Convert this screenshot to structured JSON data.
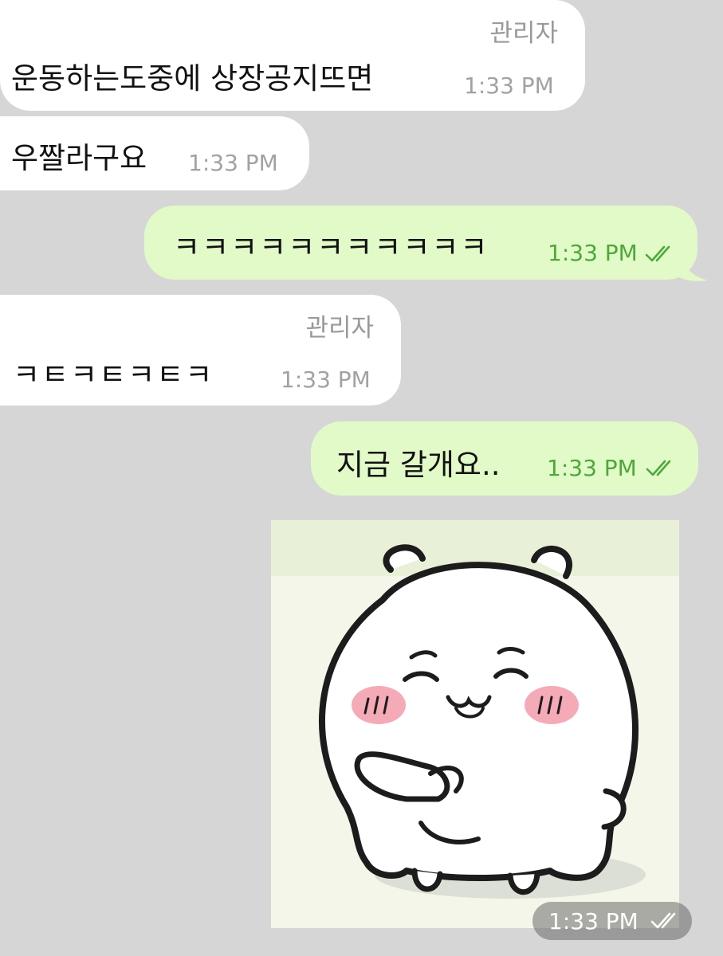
{
  "chat": {
    "messages": [
      {
        "direction": "incoming",
        "sender": "관리자",
        "text": "운동하는도중에 상장공지뜨면",
        "time": "1:33 PM"
      },
      {
        "direction": "incoming",
        "text": "우짤라구요",
        "time": "1:33 PM"
      },
      {
        "direction": "outgoing",
        "text": "ㅋㅋㅋㅋㅋㅋㅋㅋㅋㅋㅋ",
        "time": "1:33 PM",
        "status_icon": "double-check-icon"
      },
      {
        "direction": "incoming",
        "sender": "관리자",
        "text": "ㅋㅌㅋㅌㅋㅌㅋ",
        "time": "1:33 PM"
      },
      {
        "direction": "outgoing",
        "text": "지금 갈개요..",
        "time": "1:33 PM",
        "status_icon": "double-check-icon"
      }
    ],
    "sticker": {
      "icon": "white-hamster-sticker",
      "time": "1:33 PM",
      "status_icon": "double-check-icon"
    }
  },
  "colors": {
    "background": "#d6d6d6",
    "incoming_bubble": "#ffffff",
    "outgoing_bubble": "#e1fac8",
    "outgoing_time": "#4ea83a",
    "read_check": "#4ea83a",
    "sticker_time_badge": "#8a8a8a"
  }
}
